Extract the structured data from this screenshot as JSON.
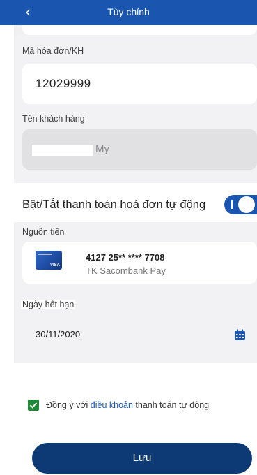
{
  "header": {
    "title": "Tùy chỉnh",
    "back_icon": "chevron-left-icon"
  },
  "invoice": {
    "label": "Mã hóa đơn/KH",
    "value": "12029999"
  },
  "customer": {
    "label": "Tên khách hàng",
    "name_suffix": "My"
  },
  "auto_pay": {
    "label": "Bật/Tắt thanh toán hoá đơn tự động",
    "enabled": true
  },
  "funding": {
    "label": "Nguồn tiền",
    "card_number": "4127 25** **** 7708",
    "card_name": "TK Sacombank Pay",
    "card_brand": "VISA"
  },
  "expiry": {
    "label": "Ngày hết hạn",
    "value": "30/11/2020",
    "icon": "calendar-icon"
  },
  "agreement": {
    "checked": true,
    "prefix": "Đồng ý với ",
    "link": "điều khoản",
    "suffix": " thanh toán tự động"
  },
  "save_label": "Lưu",
  "colors": {
    "primary": "#1a56b0",
    "button": "#0d3a74",
    "check": "#1e8a38",
    "section_bg": "#f2f2f4"
  }
}
